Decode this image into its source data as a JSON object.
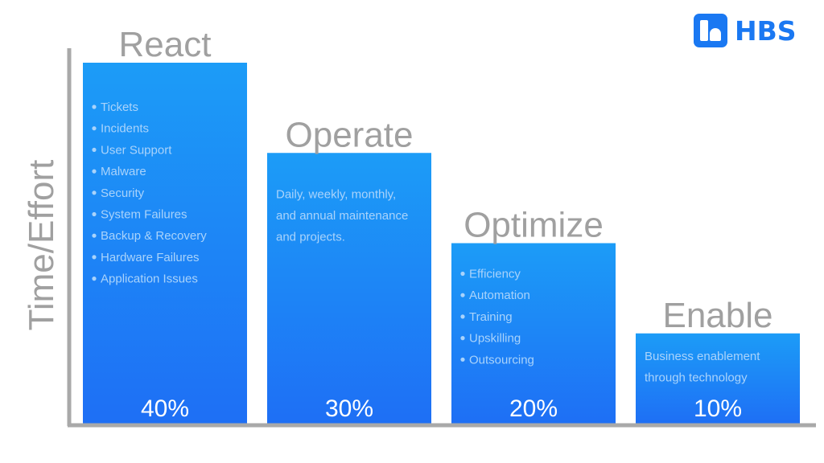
{
  "brand": {
    "name": "HBS",
    "icon": "hbs-logo-icon",
    "color": "#1a78f2"
  },
  "chart_data": {
    "type": "bar",
    "title": "",
    "xlabel": "",
    "ylabel": "Time/Effort",
    "ylim": [
      0,
      45
    ],
    "grid": false,
    "legend": "none",
    "categories": [
      "React",
      "Operate",
      "Optimize",
      "Enable"
    ],
    "values": [
      40,
      30,
      20,
      10
    ],
    "value_labels": [
      "40%",
      "30%",
      "20%",
      "10%"
    ],
    "descriptions": [
      {
        "type": "bullets",
        "items": [
          "Tickets",
          "Incidents",
          "User Support",
          "Malware",
          "Security",
          "System Failures",
          "Backup & Recovery",
          "Hardware Failures",
          "Application Issues"
        ]
      },
      {
        "type": "text",
        "lines": [
          "Daily, weekly, monthly,",
          "and annual maintenance",
          "and projects."
        ]
      },
      {
        "type": "bullets",
        "items": [
          "Efficiency",
          "Automation",
          "Training",
          "Upskilling",
          "Outsourcing"
        ]
      },
      {
        "type": "text",
        "lines": [
          "Business enablement",
          "through technology"
        ]
      }
    ],
    "colors": {
      "bar_top": "#1c9cf7",
      "bar_bottom": "#1e6ff5",
      "axis": "#a9a9a9",
      "category_label": "#a0a0a0",
      "ylabel": "#a0a0a0",
      "desc_text": "#a9d3fb",
      "value_label": "#ffffff"
    }
  }
}
